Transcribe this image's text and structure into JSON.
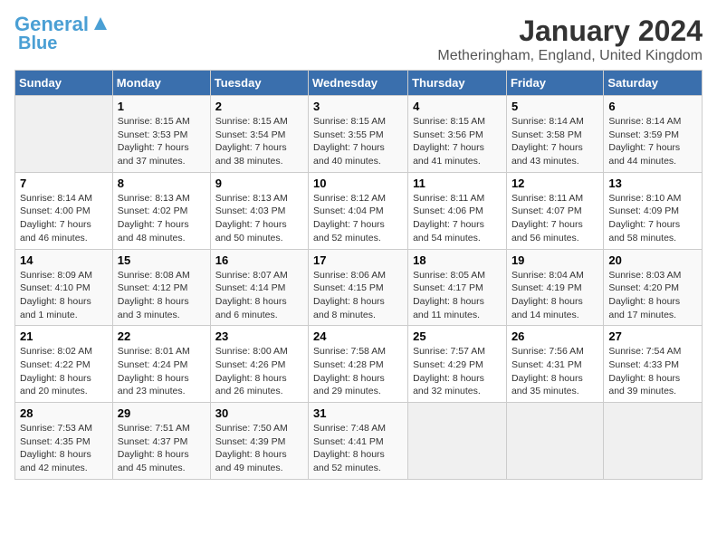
{
  "header": {
    "logo_line1": "General",
    "logo_line2": "Blue",
    "month_year": "January 2024",
    "location": "Metheringham, England, United Kingdom"
  },
  "days_of_week": [
    "Sunday",
    "Monday",
    "Tuesday",
    "Wednesday",
    "Thursday",
    "Friday",
    "Saturday"
  ],
  "weeks": [
    [
      {
        "num": "",
        "sunrise": "",
        "sunset": "",
        "daylight": ""
      },
      {
        "num": "1",
        "sunrise": "8:15 AM",
        "sunset": "3:53 PM",
        "daylight": "7 hours and 37 minutes."
      },
      {
        "num": "2",
        "sunrise": "8:15 AM",
        "sunset": "3:54 PM",
        "daylight": "7 hours and 38 minutes."
      },
      {
        "num": "3",
        "sunrise": "8:15 AM",
        "sunset": "3:55 PM",
        "daylight": "7 hours and 40 minutes."
      },
      {
        "num": "4",
        "sunrise": "8:15 AM",
        "sunset": "3:56 PM",
        "daylight": "7 hours and 41 minutes."
      },
      {
        "num": "5",
        "sunrise": "8:14 AM",
        "sunset": "3:58 PM",
        "daylight": "7 hours and 43 minutes."
      },
      {
        "num": "6",
        "sunrise": "8:14 AM",
        "sunset": "3:59 PM",
        "daylight": "7 hours and 44 minutes."
      }
    ],
    [
      {
        "num": "7",
        "sunrise": "8:14 AM",
        "sunset": "4:00 PM",
        "daylight": "7 hours and 46 minutes."
      },
      {
        "num": "8",
        "sunrise": "8:13 AM",
        "sunset": "4:02 PM",
        "daylight": "7 hours and 48 minutes."
      },
      {
        "num": "9",
        "sunrise": "8:13 AM",
        "sunset": "4:03 PM",
        "daylight": "7 hours and 50 minutes."
      },
      {
        "num": "10",
        "sunrise": "8:12 AM",
        "sunset": "4:04 PM",
        "daylight": "7 hours and 52 minutes."
      },
      {
        "num": "11",
        "sunrise": "8:11 AM",
        "sunset": "4:06 PM",
        "daylight": "7 hours and 54 minutes."
      },
      {
        "num": "12",
        "sunrise": "8:11 AM",
        "sunset": "4:07 PM",
        "daylight": "7 hours and 56 minutes."
      },
      {
        "num": "13",
        "sunrise": "8:10 AM",
        "sunset": "4:09 PM",
        "daylight": "7 hours and 58 minutes."
      }
    ],
    [
      {
        "num": "14",
        "sunrise": "8:09 AM",
        "sunset": "4:10 PM",
        "daylight": "8 hours and 1 minute."
      },
      {
        "num": "15",
        "sunrise": "8:08 AM",
        "sunset": "4:12 PM",
        "daylight": "8 hours and 3 minutes."
      },
      {
        "num": "16",
        "sunrise": "8:07 AM",
        "sunset": "4:14 PM",
        "daylight": "8 hours and 6 minutes."
      },
      {
        "num": "17",
        "sunrise": "8:06 AM",
        "sunset": "4:15 PM",
        "daylight": "8 hours and 8 minutes."
      },
      {
        "num": "18",
        "sunrise": "8:05 AM",
        "sunset": "4:17 PM",
        "daylight": "8 hours and 11 minutes."
      },
      {
        "num": "19",
        "sunrise": "8:04 AM",
        "sunset": "4:19 PM",
        "daylight": "8 hours and 14 minutes."
      },
      {
        "num": "20",
        "sunrise": "8:03 AM",
        "sunset": "4:20 PM",
        "daylight": "8 hours and 17 minutes."
      }
    ],
    [
      {
        "num": "21",
        "sunrise": "8:02 AM",
        "sunset": "4:22 PM",
        "daylight": "8 hours and 20 minutes."
      },
      {
        "num": "22",
        "sunrise": "8:01 AM",
        "sunset": "4:24 PM",
        "daylight": "8 hours and 23 minutes."
      },
      {
        "num": "23",
        "sunrise": "8:00 AM",
        "sunset": "4:26 PM",
        "daylight": "8 hours and 26 minutes."
      },
      {
        "num": "24",
        "sunrise": "7:58 AM",
        "sunset": "4:28 PM",
        "daylight": "8 hours and 29 minutes."
      },
      {
        "num": "25",
        "sunrise": "7:57 AM",
        "sunset": "4:29 PM",
        "daylight": "8 hours and 32 minutes."
      },
      {
        "num": "26",
        "sunrise": "7:56 AM",
        "sunset": "4:31 PM",
        "daylight": "8 hours and 35 minutes."
      },
      {
        "num": "27",
        "sunrise": "7:54 AM",
        "sunset": "4:33 PM",
        "daylight": "8 hours and 39 minutes."
      }
    ],
    [
      {
        "num": "28",
        "sunrise": "7:53 AM",
        "sunset": "4:35 PM",
        "daylight": "8 hours and 42 minutes."
      },
      {
        "num": "29",
        "sunrise": "7:51 AM",
        "sunset": "4:37 PM",
        "daylight": "8 hours and 45 minutes."
      },
      {
        "num": "30",
        "sunrise": "7:50 AM",
        "sunset": "4:39 PM",
        "daylight": "8 hours and 49 minutes."
      },
      {
        "num": "31",
        "sunrise": "7:48 AM",
        "sunset": "4:41 PM",
        "daylight": "8 hours and 52 minutes."
      },
      {
        "num": "",
        "sunrise": "",
        "sunset": "",
        "daylight": ""
      },
      {
        "num": "",
        "sunrise": "",
        "sunset": "",
        "daylight": ""
      },
      {
        "num": "",
        "sunrise": "",
        "sunset": "",
        "daylight": ""
      }
    ]
  ]
}
